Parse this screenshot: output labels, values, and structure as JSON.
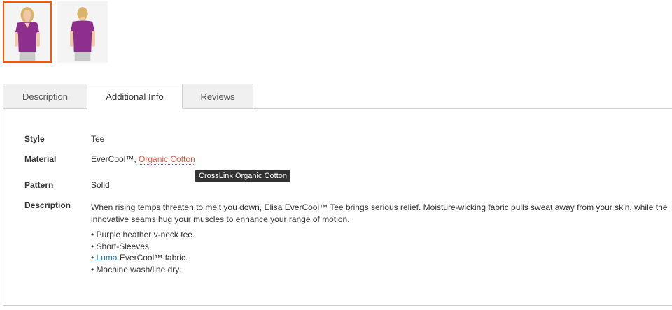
{
  "gallery": {
    "thumbnails": [
      {
        "alt": "front view",
        "selected": true
      },
      {
        "alt": "back view",
        "selected": false
      }
    ],
    "accent_color": "#ff5501"
  },
  "tabs": [
    {
      "label": "Description",
      "active": false
    },
    {
      "label": "Additional Info",
      "active": true
    },
    {
      "label": "Reviews",
      "active": false
    }
  ],
  "info": {
    "style": {
      "label": "Style",
      "value": "Tee"
    },
    "material": {
      "label": "Material",
      "value_prefix": "EverCool™, ",
      "link": "Organic Cotton"
    },
    "pattern": {
      "label": "Pattern",
      "value": "Solid"
    },
    "description": {
      "label": "Description",
      "text": "When rising temps threaten to melt you down, Elisa EverCool™ Tee brings serious relief. Moisture-wicking fabric pulls sweat away from your skin, while the innovative seams hug your muscles to enhance your range of motion.",
      "bullets": {
        "b1": "• Purple heather v-neck tee.",
        "b2": "• Short-Sleeves.",
        "b3_prefix": "• ",
        "b3_link": "Luma",
        "b3_suffix": " EverCool™ fabric.",
        "b4": "• Machine wash/line dry."
      }
    }
  },
  "tooltip": "CrossLink Organic Cotton"
}
